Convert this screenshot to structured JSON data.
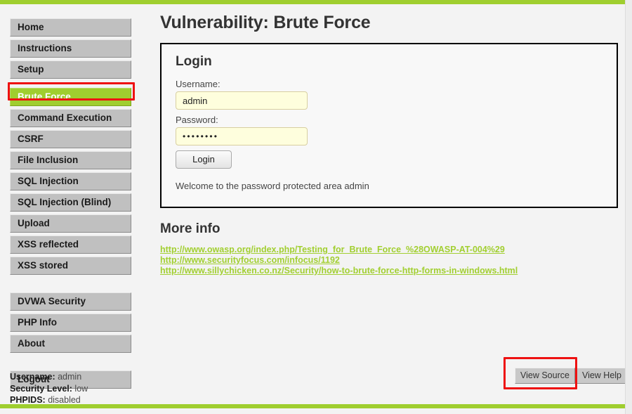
{
  "theme": {
    "accent_green": "#9fce2f",
    "link_green": "#a2cf31",
    "annotation_red": "#ee1111",
    "nav_gray": "#c0c0c0",
    "input_yellow": "#fefedd"
  },
  "sidebar": {
    "groups": [
      {
        "name": "general",
        "items": [
          {
            "label": "Home",
            "active": false
          },
          {
            "label": "Instructions",
            "active": false
          },
          {
            "label": "Setup",
            "active": false
          }
        ]
      },
      {
        "name": "vulnerabilities",
        "items": [
          {
            "label": "Brute Force",
            "active": true
          },
          {
            "label": "Command Execution",
            "active": false
          },
          {
            "label": "CSRF",
            "active": false
          },
          {
            "label": "File Inclusion",
            "active": false
          },
          {
            "label": "SQL Injection",
            "active": false
          },
          {
            "label": "SQL Injection (Blind)",
            "active": false
          },
          {
            "label": "Upload",
            "active": false
          },
          {
            "label": "XSS reflected",
            "active": false
          },
          {
            "label": "XSS stored",
            "active": false
          }
        ]
      },
      {
        "name": "settings",
        "items": [
          {
            "label": "DVWA Security",
            "active": false
          },
          {
            "label": "PHP Info",
            "active": false
          },
          {
            "label": "About",
            "active": false
          }
        ]
      },
      {
        "name": "session",
        "items": [
          {
            "label": "Logout",
            "active": false
          }
        ]
      }
    ],
    "status": {
      "username_key": "Username:",
      "username_value": "admin",
      "security_level_key": "Security Level:",
      "security_level_value": "low",
      "phpids_key": "PHPIDS:",
      "phpids_value": "disabled"
    }
  },
  "main": {
    "page_title": "Vulnerability: Brute Force",
    "login_box": {
      "heading": "Login",
      "username_label": "Username:",
      "username_value": "admin",
      "username_placeholder": "",
      "password_label": "Password:",
      "password_value": "••••••••",
      "password_placeholder": "",
      "submit_label": "Login",
      "message": "Welcome to the password protected area admin"
    },
    "more_info": {
      "heading": "More info",
      "links": [
        "http://www.owasp.org/index.php/Testing_for_Brute_Force_%28OWASP-AT-004%29",
        "http://www.securityfocus.com/infocus/1192",
        "http://www.sillychicken.co.nz/Security/how-to-brute-force-http-forms-in-windows.html"
      ]
    },
    "footer_buttons": {
      "view_source": "View Source",
      "view_help": "View Help"
    }
  }
}
